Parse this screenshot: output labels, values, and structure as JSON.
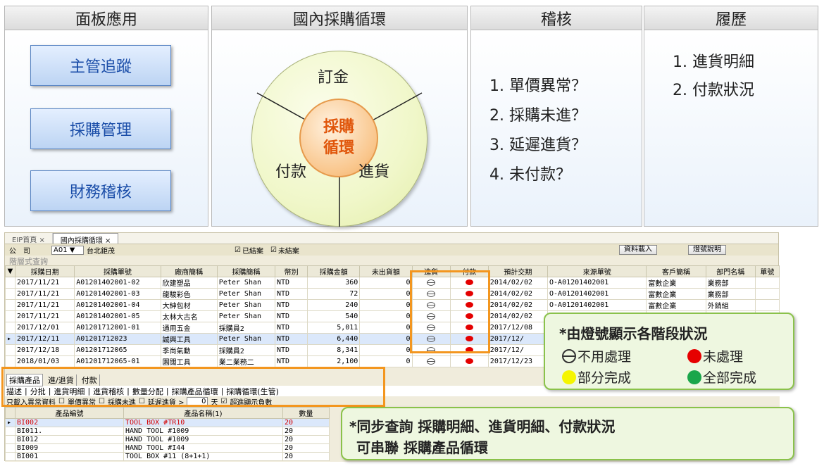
{
  "panels": {
    "apps_title": "面板應用",
    "cycle_title": "國內採購循環",
    "audit_title": "稽核",
    "history_title": "履歷"
  },
  "apps": {
    "btn1": "主管追蹤",
    "btn2": "採購管理",
    "btn3": "財務稽核"
  },
  "cycle": {
    "center_line1": "採購",
    "center_line2": "循環",
    "deposit": "訂金",
    "payment": "付款",
    "receiving": "進貨"
  },
  "audit": {
    "items": [
      "1. 單價異常？",
      "2. 採購未進？",
      "3. 延遲進貨？",
      "4. 未付款？"
    ]
  },
  "history": {
    "items": [
      "1. 進貨明細",
      "2. 付款狀況"
    ]
  },
  "app": {
    "tabs": [
      "EIP首頁 ×",
      "國內採購循環 ×"
    ],
    "company_label": "公　司",
    "company_code": "A01",
    "company_name": "台北鉅茂",
    "closed_label": "已結案",
    "open_label": "未結案",
    "load_button": "資料載入",
    "light_help_button": "燈號說明",
    "section_label": "階層式查詢",
    "columns": [
      "採購日期",
      "採購單號",
      "廠商簡稱",
      "採購簡稱",
      "幣別",
      "採購金額",
      "未出貨額",
      "進貨",
      "付款",
      "預計交期",
      "來源單號",
      "客戶簡稱",
      "部門名稱",
      "單號"
    ],
    "rows": [
      [
        "2017/11/21",
        "A01201402001-02",
        "欣建塑品",
        "Peter Shan",
        "NTD",
        "360",
        "0",
        "gray",
        "red",
        "2014/02/02",
        "O-A01201402001",
        "富數企業",
        "業務部"
      ],
      [
        "2017/11/21",
        "A01201402001-03",
        "龍駿彩色",
        "Peter Shan",
        "NTD",
        "72",
        "0",
        "gray",
        "red",
        "2014/02/02",
        "O-A01201402001",
        "富數企業",
        "業務部"
      ],
      [
        "2017/11/21",
        "A01201402001-04",
        "大紳包材",
        "Peter Shan",
        "NTD",
        "240",
        "0",
        "gray",
        "red",
        "2014/02/02",
        "O-A01201402001",
        "富數企業",
        "外銷組"
      ],
      [
        "2017/11/21",
        "A01201402001-05",
        "太林大古名",
        "Peter Shan",
        "NTD",
        "540",
        "0",
        "gray",
        "red",
        "2014/02/02",
        "O-A01201402001",
        "富數企業",
        "外銷組"
      ],
      [
        "2017/12/01",
        "A01201712001-01",
        "通用五金",
        "採購員2",
        "NTD",
        "5,011",
        "0",
        "gray",
        "red",
        "2017/12/08",
        "",
        "",
        ""
      ],
      [
        "2017/12/11",
        "A01201712023",
        "誠興工具",
        "Peter Shan",
        "NTD",
        "6,440",
        "0",
        "gray",
        "red",
        "2017/12/",
        "",
        "",
        ""
      ],
      [
        "2017/12/18",
        "A01201712065",
        "季尚氣動",
        "採購員2",
        "NTD",
        "8,341",
        "0",
        "gray",
        "red",
        "2017/12/",
        "",
        "",
        ""
      ],
      [
        "2018/01/03",
        "A01201712065-01",
        "園闊工具",
        "業二業務二",
        "NTD",
        "2,100",
        "0",
        "gray",
        "red",
        "2017/12/23",
        "",
        "",
        ""
      ]
    ],
    "sub_tabs": [
      "採購產品",
      "進/退貨",
      "付款"
    ],
    "sub_buttons": [
      "描述",
      "分批",
      "進貨明細",
      "進貨稽核",
      "數量分配",
      "採購產品循環",
      "採購循環(生管)"
    ],
    "filter_text": "只載入異常資料",
    "filter_price": "單價異常",
    "filter_notin": "採購未進",
    "filter_delay": "延遲進貨 >",
    "filter_days": "0",
    "filter_days_unit": "天",
    "filter_overdue": "超進顯示負數",
    "product_columns": [
      "產品編號",
      "產品名稱(1)",
      "數量"
    ],
    "products": [
      [
        "BI002",
        "TOOL BOX #TR10",
        "20"
      ],
      [
        "BI011.",
        "HAND TOOL #1009",
        "20"
      ],
      [
        "BI012",
        "HAND TOOL #1009",
        "20"
      ],
      [
        "BI009",
        "HAND TOOL #I44",
        "20"
      ],
      [
        "BI001",
        "TOOL BOX #11 (8+1+1)",
        "20"
      ]
    ]
  },
  "callout_lights": {
    "title": "*由燈號顯示各階段狀況",
    "none": "不用處理",
    "unprocessed": "未處理",
    "partial": "部分完成",
    "complete": "全部完成",
    "color_unprocessed": "#e60000",
    "color_partial": "#f5f500",
    "color_complete": "#1aa64a"
  },
  "callout_sync": {
    "line1": "*同步查詢 採購明細、進貨明細、付款狀況",
    "line2": "可串聯 採購產品循環"
  }
}
